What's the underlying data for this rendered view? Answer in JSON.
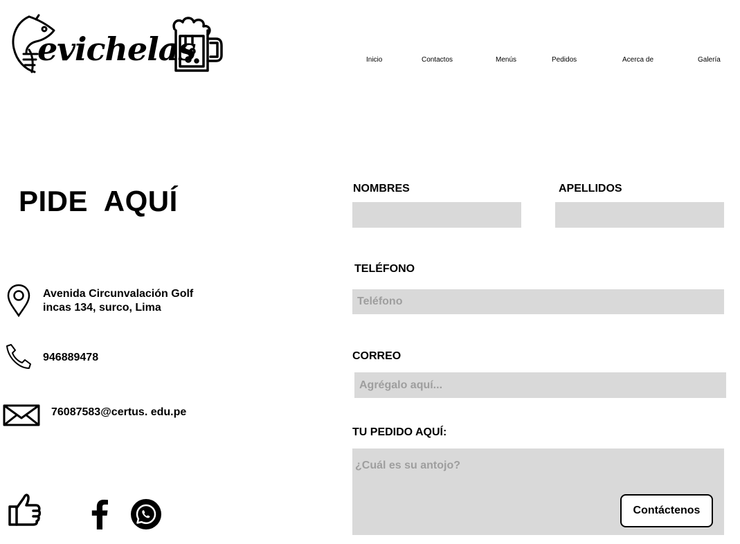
{
  "logo": {
    "text": "evichelas",
    "fish_icon": "fish-icon",
    "mug_icon": "beer-mug-icon"
  },
  "nav": {
    "items": [
      {
        "label": "Inicio"
      },
      {
        "label": "Contactos"
      },
      {
        "label": "Menús"
      },
      {
        "label": "Pedidos"
      },
      {
        "label": "Acerca de"
      },
      {
        "label": "Galería"
      }
    ]
  },
  "page": {
    "title": "PIDE  AQUÍ"
  },
  "contact": {
    "address_line1": "Avenida Circunvalación Golf",
    "address_line2": "incas 134, surco, Lima",
    "phone": "946889478",
    "email": "76087583@certus. edu.pe",
    "icons": [
      "location-pin-icon",
      "phone-icon",
      "mail-icon"
    ]
  },
  "social": {
    "icons": [
      "thumbs-up-icon",
      "facebook-icon",
      "whatsapp-icon"
    ]
  },
  "form": {
    "nombres": {
      "label": "NOMBRES",
      "value": "",
      "placeholder": ""
    },
    "apellidos": {
      "label": "APELLIDOS",
      "value": "",
      "placeholder": ""
    },
    "telefono": {
      "label": "TELÉFONO",
      "value": "",
      "placeholder": "Teléfono"
    },
    "correo": {
      "label": "CORREO",
      "value": "",
      "placeholder": "Agrégalo aquí..."
    },
    "pedido": {
      "label": "TU PEDIDO AQUÍ:",
      "value": "",
      "placeholder": "¿Cuál es su antojo?"
    },
    "submit_label": "Contáctenos"
  }
}
